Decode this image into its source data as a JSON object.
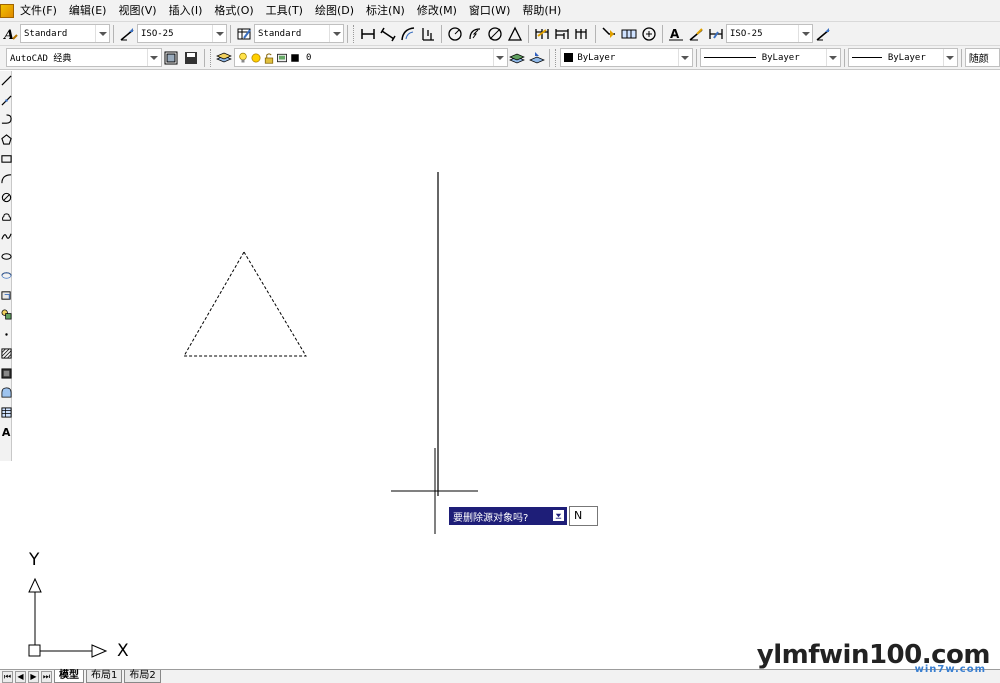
{
  "menu": {
    "items": [
      "文件(F)",
      "编辑(E)",
      "视图(V)",
      "插入(I)",
      "格式(O)",
      "工具(T)",
      "绘图(D)",
      "标注(N)",
      "修改(M)",
      "窗口(W)",
      "帮助(H)"
    ]
  },
  "toolbar1": {
    "text_style": "Standard",
    "dim_style": "ISO-25",
    "table_style": "Standard",
    "dim_style_right": "ISO-25"
  },
  "toolbar2": {
    "workspace": "AutoCAD 经典",
    "layer": "0",
    "color": "ByLayer",
    "linetype": "ByLayer",
    "lineweight": "ByLayer",
    "plot_style": "随颜"
  },
  "prompt": {
    "question": "要删除源对象吗?",
    "input_value": "N"
  },
  "ucs": {
    "x_label": "X",
    "y_label": "Y"
  },
  "tabs": {
    "items": [
      "模型",
      "布局1",
      "布局2"
    ],
    "active": "模型"
  },
  "watermark": {
    "main": "ylmfwin100.com",
    "sub": "win7w.com"
  },
  "colors": {
    "chrome": "#f2f2f2",
    "prompt_bg": "#1e1e78",
    "canvas": "#ffffff"
  }
}
